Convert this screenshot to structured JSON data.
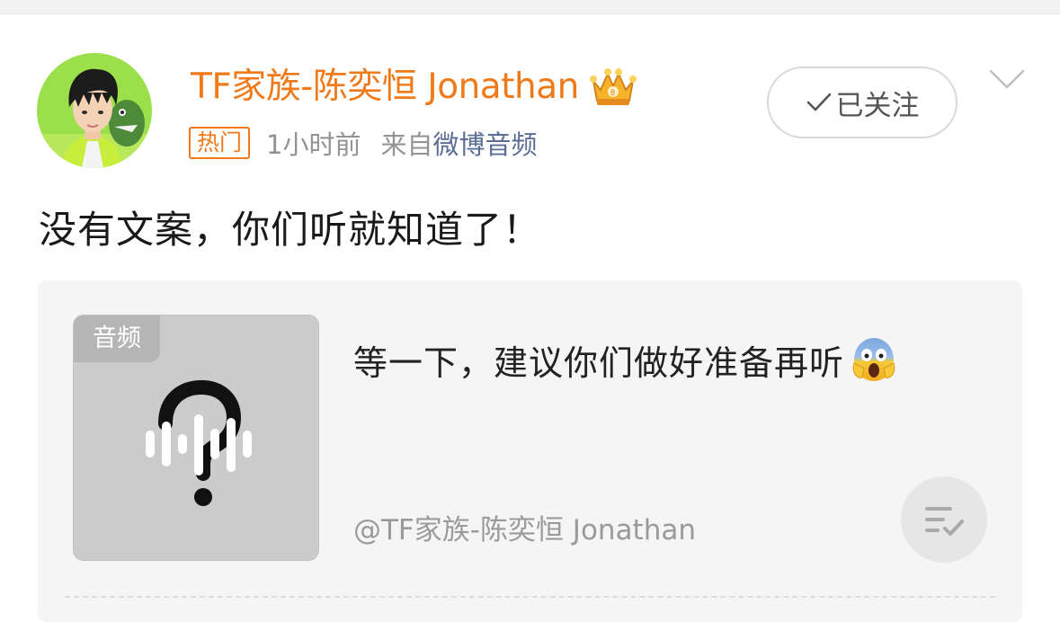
{
  "post": {
    "author_name": "TF家族-陈奕恒 Jonathan",
    "badge": "热门",
    "time": "1小时前",
    "from_label": "来自",
    "source": "微博音频",
    "follow_label": "已关注",
    "text": "没有文案，你们听就知道了！"
  },
  "audio_card": {
    "cover_tag": "音频",
    "title": "等一下，建议你们做好准备再听",
    "author": "@TF家族-陈奕恒 Jonathan"
  },
  "colors": {
    "accent_orange": "#f07a1a",
    "source_link": "#5b6d95",
    "card_bg": "#f5f5f5"
  },
  "icons": {
    "crown": "crown-icon",
    "check": "check-icon",
    "chevron": "chevron-down-icon",
    "audio_art": "question-waveform-icon",
    "scream": "screaming-face-emoji",
    "playlist": "playlist-check-icon"
  }
}
